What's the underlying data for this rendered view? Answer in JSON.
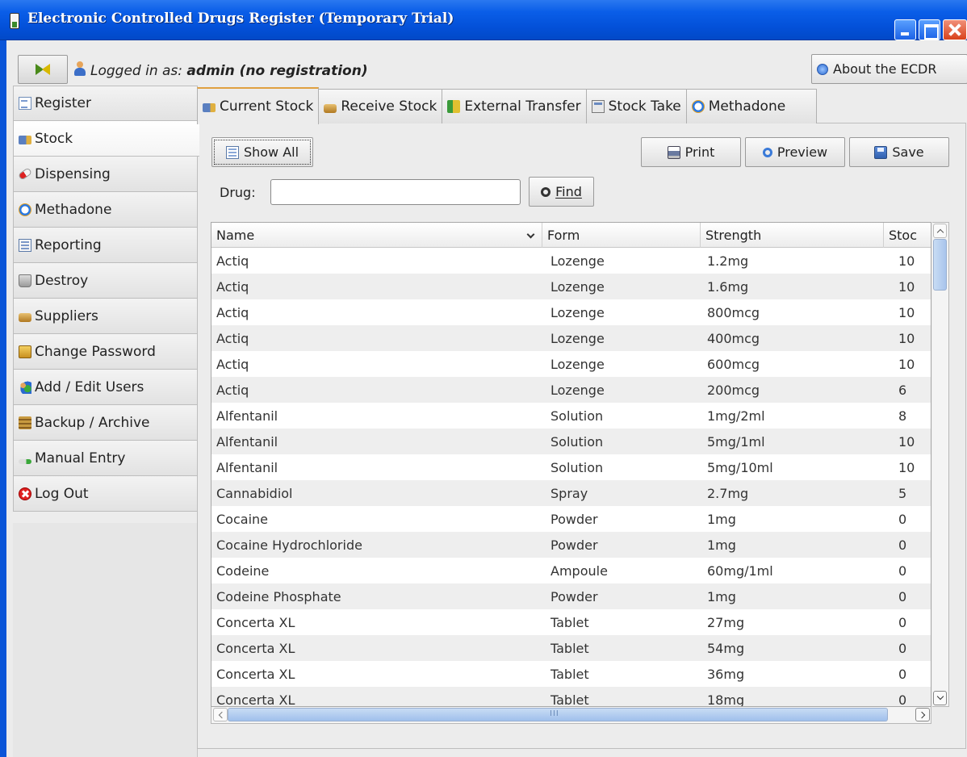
{
  "window": {
    "title": "Electronic Controlled Drugs Register (Temporary Trial)",
    "icons": {
      "app": "app-icon",
      "minimize": "minimize-icon",
      "maximize": "maximize-icon",
      "close": "close-icon"
    }
  },
  "header": {
    "logged_in_label": "Logged in as:",
    "logged_in_user": "admin (no registration)",
    "about_label": "About the ECDR"
  },
  "sidebar": {
    "items": [
      {
        "label": "Register",
        "icon": "register-icon"
      },
      {
        "label": "Stock",
        "icon": "stock-icon",
        "active": true
      },
      {
        "label": "Dispensing",
        "icon": "pill-icon"
      },
      {
        "label": "Methadone",
        "icon": "clock-icon"
      },
      {
        "label": "Reporting",
        "icon": "report-icon"
      },
      {
        "label": "Destroy",
        "icon": "bin-icon"
      },
      {
        "label": "Suppliers",
        "icon": "suppliers-icon"
      },
      {
        "label": "Change Password",
        "icon": "lock-icon"
      },
      {
        "label": "Add / Edit Users",
        "icon": "users-icon"
      },
      {
        "label": "Backup / Archive",
        "icon": "backup-icon"
      },
      {
        "label": "Manual Entry",
        "icon": "manual-entry-icon"
      },
      {
        "label": "Log Out",
        "icon": "logout-icon"
      }
    ]
  },
  "tabs": [
    {
      "label": "Current Stock",
      "active": true
    },
    {
      "label": "Receive Stock"
    },
    {
      "label": "External Transfer"
    },
    {
      "label": "Stock Take"
    },
    {
      "label": "Methadone"
    }
  ],
  "toolbar": {
    "show_all": "Show All",
    "print": "Print",
    "preview": "Preview",
    "save": "Save",
    "drug_label": "Drug:",
    "drug_value": "",
    "find": "Find"
  },
  "table": {
    "columns": [
      "Name",
      "Form",
      "Strength",
      "Stoc"
    ],
    "rows": [
      [
        "Actiq",
        "Lozenge",
        "1.2mg",
        "10"
      ],
      [
        "Actiq",
        "Lozenge",
        "1.6mg",
        "10"
      ],
      [
        "Actiq",
        "Lozenge",
        "800mcg",
        "10"
      ],
      [
        "Actiq",
        "Lozenge",
        "400mcg",
        "10"
      ],
      [
        "Actiq",
        "Lozenge",
        "600mcg",
        "10"
      ],
      [
        "Actiq",
        "Lozenge",
        "200mcg",
        "6"
      ],
      [
        "Alfentanil",
        "Solution",
        "1mg/2ml",
        "8"
      ],
      [
        "Alfentanil",
        "Solution",
        "5mg/1ml",
        "10"
      ],
      [
        "Alfentanil",
        "Solution",
        "5mg/10ml",
        "10"
      ],
      [
        "Cannabidiol",
        "Spray",
        "2.7mg",
        "5"
      ],
      [
        "Cocaine",
        "Powder",
        "1mg",
        "0"
      ],
      [
        "Cocaine Hydrochloride",
        "Powder",
        "1mg",
        "0"
      ],
      [
        "Codeine",
        "Ampoule",
        "60mg/1ml",
        "0"
      ],
      [
        "Codeine Phosphate",
        "Powder",
        "1mg",
        "0"
      ],
      [
        "Concerta XL",
        "Tablet",
        "27mg",
        "0"
      ],
      [
        "Concerta XL",
        "Tablet",
        "54mg",
        "0"
      ],
      [
        "Concerta XL",
        "Tablet",
        "36mg",
        "0"
      ],
      [
        "Concerta XL",
        "Tablet",
        "18mg",
        "0"
      ]
    ]
  }
}
